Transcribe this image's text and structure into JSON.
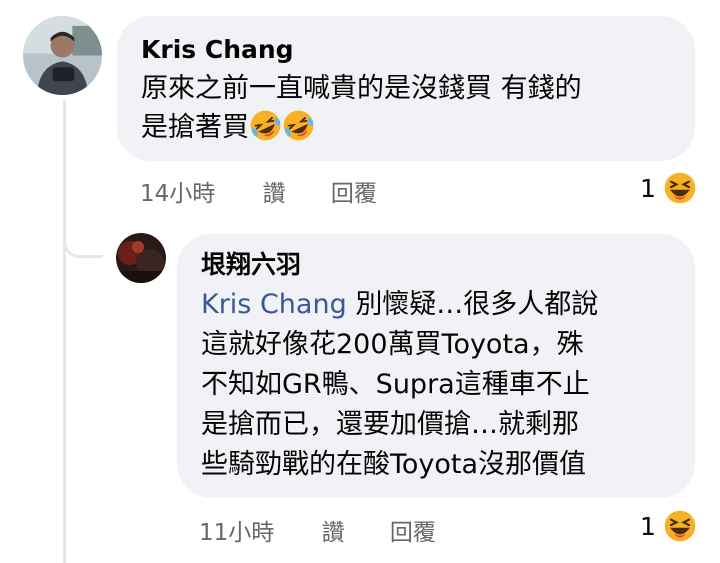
{
  "comments": [
    {
      "author": "Kris Chang",
      "lines": [
        "原來之前一直喊貴的是沒錢買 有錢的",
        "是搶著買"
      ],
      "time": "14小時",
      "like_label": "讚",
      "reply_label": "回覆",
      "reaction_count": "1"
    },
    {
      "author": "垠翔六羽",
      "mention": "Kris Chang",
      "lines": [
        "別懷疑…很多人都說",
        "這就好像花200萬買Toyota，殊",
        "不知如GR鴨、Supra這種車不止",
        "是搶而已，還要加價搶…就剩那",
        "些騎勁戰的在酸Toyota沒那價值"
      ],
      "time": "11小時",
      "like_label": "讚",
      "reply_label": "回覆",
      "reaction_count": "1"
    }
  ],
  "colors": {
    "bubble": "#f0f2f5",
    "mention": "#385898",
    "meta": "#65676b",
    "thread_line": "#e4e6ea",
    "haha": "#f7b125"
  },
  "icons": {
    "reaction": "haha-emoji-icon",
    "inline_emoji": "rolling-laughing-emoji-icon"
  }
}
